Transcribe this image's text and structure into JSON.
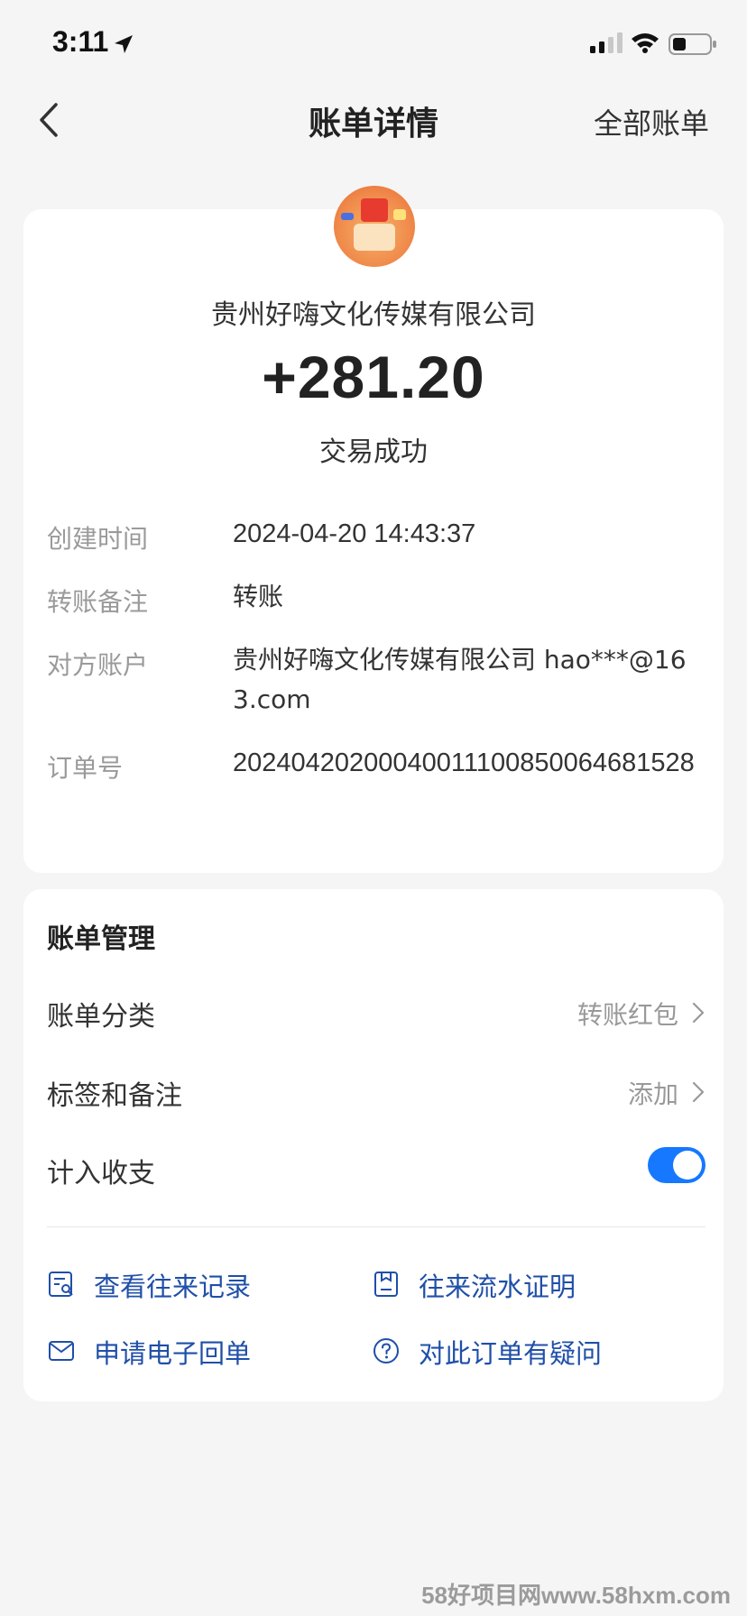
{
  "status_bar": {
    "time": "3:11"
  },
  "nav": {
    "title": "账单详情",
    "right_label": "全部账单"
  },
  "transaction": {
    "merchant": "贵州好嗨文化传媒有限公司",
    "amount": "+281.20",
    "status": "交易成功"
  },
  "details": [
    {
      "label": "创建时间",
      "value": "2024-04-20 14:43:37"
    },
    {
      "label": "转账备注",
      "value": "转账"
    },
    {
      "label": "对方账户",
      "value": "贵州好嗨文化传媒有限公司 hao***@163.com"
    },
    {
      "label": "订单号",
      "value": "20240420200040011100850064681528"
    }
  ],
  "manage": {
    "title": "账单管理",
    "category_label": "账单分类",
    "category_value": "转账红包",
    "tags_label": "标签和备注",
    "tags_value": "添加",
    "include_label": "计入收支",
    "include_on": true
  },
  "actions": [
    {
      "label": "查看往来记录",
      "icon": "records-search-icon"
    },
    {
      "label": "往来流水证明",
      "icon": "statement-proof-icon"
    },
    {
      "label": "申请电子回单",
      "icon": "envelope-icon"
    },
    {
      "label": "对此订单有疑问",
      "icon": "question-circle-icon"
    }
  ],
  "colors": {
    "accent": "#1677ff",
    "link": "#1f4fa8",
    "background": "#f5f5f5"
  },
  "watermark": "58好项目网www.58hxm.com"
}
